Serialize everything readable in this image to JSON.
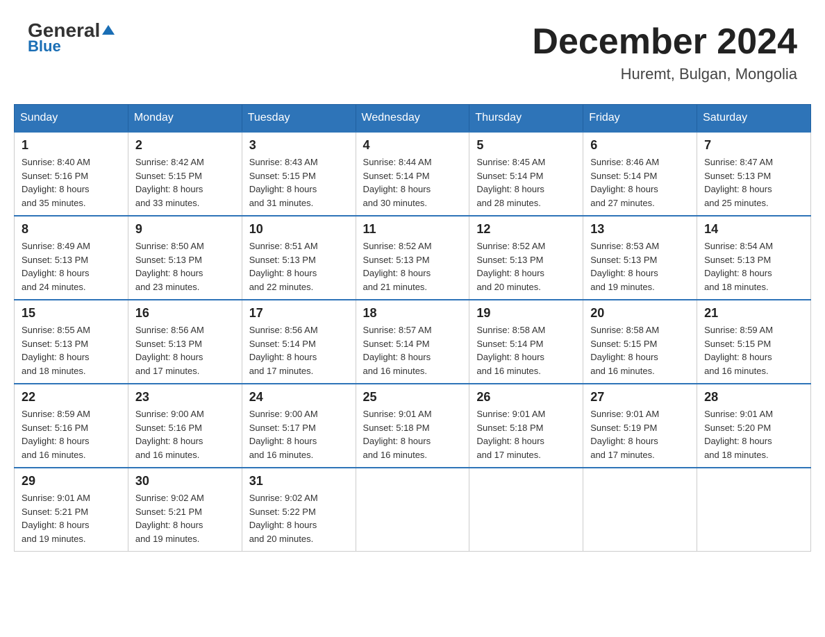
{
  "header": {
    "logo_main": "General",
    "logo_blue": "Blue",
    "month_title": "December 2024",
    "location": "Huremt, Bulgan, Mongolia"
  },
  "days_of_week": [
    "Sunday",
    "Monday",
    "Tuesday",
    "Wednesday",
    "Thursday",
    "Friday",
    "Saturday"
  ],
  "weeks": [
    [
      {
        "day": "1",
        "sunrise": "8:40 AM",
        "sunset": "5:16 PM",
        "daylight": "8 hours and 35 minutes."
      },
      {
        "day": "2",
        "sunrise": "8:42 AM",
        "sunset": "5:15 PM",
        "daylight": "8 hours and 33 minutes."
      },
      {
        "day": "3",
        "sunrise": "8:43 AM",
        "sunset": "5:15 PM",
        "daylight": "8 hours and 31 minutes."
      },
      {
        "day": "4",
        "sunrise": "8:44 AM",
        "sunset": "5:14 PM",
        "daylight": "8 hours and 30 minutes."
      },
      {
        "day": "5",
        "sunrise": "8:45 AM",
        "sunset": "5:14 PM",
        "daylight": "8 hours and 28 minutes."
      },
      {
        "day": "6",
        "sunrise": "8:46 AM",
        "sunset": "5:14 PM",
        "daylight": "8 hours and 27 minutes."
      },
      {
        "day": "7",
        "sunrise": "8:47 AM",
        "sunset": "5:13 PM",
        "daylight": "8 hours and 25 minutes."
      }
    ],
    [
      {
        "day": "8",
        "sunrise": "8:49 AM",
        "sunset": "5:13 PM",
        "daylight": "8 hours and 24 minutes."
      },
      {
        "day": "9",
        "sunrise": "8:50 AM",
        "sunset": "5:13 PM",
        "daylight": "8 hours and 23 minutes."
      },
      {
        "day": "10",
        "sunrise": "8:51 AM",
        "sunset": "5:13 PM",
        "daylight": "8 hours and 22 minutes."
      },
      {
        "day": "11",
        "sunrise": "8:52 AM",
        "sunset": "5:13 PM",
        "daylight": "8 hours and 21 minutes."
      },
      {
        "day": "12",
        "sunrise": "8:52 AM",
        "sunset": "5:13 PM",
        "daylight": "8 hours and 20 minutes."
      },
      {
        "day": "13",
        "sunrise": "8:53 AM",
        "sunset": "5:13 PM",
        "daylight": "8 hours and 19 minutes."
      },
      {
        "day": "14",
        "sunrise": "8:54 AM",
        "sunset": "5:13 PM",
        "daylight": "8 hours and 18 minutes."
      }
    ],
    [
      {
        "day": "15",
        "sunrise": "8:55 AM",
        "sunset": "5:13 PM",
        "daylight": "8 hours and 18 minutes."
      },
      {
        "day": "16",
        "sunrise": "8:56 AM",
        "sunset": "5:13 PM",
        "daylight": "8 hours and 17 minutes."
      },
      {
        "day": "17",
        "sunrise": "8:56 AM",
        "sunset": "5:14 PM",
        "daylight": "8 hours and 17 minutes."
      },
      {
        "day": "18",
        "sunrise": "8:57 AM",
        "sunset": "5:14 PM",
        "daylight": "8 hours and 16 minutes."
      },
      {
        "day": "19",
        "sunrise": "8:58 AM",
        "sunset": "5:14 PM",
        "daylight": "8 hours and 16 minutes."
      },
      {
        "day": "20",
        "sunrise": "8:58 AM",
        "sunset": "5:15 PM",
        "daylight": "8 hours and 16 minutes."
      },
      {
        "day": "21",
        "sunrise": "8:59 AM",
        "sunset": "5:15 PM",
        "daylight": "8 hours and 16 minutes."
      }
    ],
    [
      {
        "day": "22",
        "sunrise": "8:59 AM",
        "sunset": "5:16 PM",
        "daylight": "8 hours and 16 minutes."
      },
      {
        "day": "23",
        "sunrise": "9:00 AM",
        "sunset": "5:16 PM",
        "daylight": "8 hours and 16 minutes."
      },
      {
        "day": "24",
        "sunrise": "9:00 AM",
        "sunset": "5:17 PM",
        "daylight": "8 hours and 16 minutes."
      },
      {
        "day": "25",
        "sunrise": "9:01 AM",
        "sunset": "5:18 PM",
        "daylight": "8 hours and 16 minutes."
      },
      {
        "day": "26",
        "sunrise": "9:01 AM",
        "sunset": "5:18 PM",
        "daylight": "8 hours and 17 minutes."
      },
      {
        "day": "27",
        "sunrise": "9:01 AM",
        "sunset": "5:19 PM",
        "daylight": "8 hours and 17 minutes."
      },
      {
        "day": "28",
        "sunrise": "9:01 AM",
        "sunset": "5:20 PM",
        "daylight": "8 hours and 18 minutes."
      }
    ],
    [
      {
        "day": "29",
        "sunrise": "9:01 AM",
        "sunset": "5:21 PM",
        "daylight": "8 hours and 19 minutes."
      },
      {
        "day": "30",
        "sunrise": "9:02 AM",
        "sunset": "5:21 PM",
        "daylight": "8 hours and 19 minutes."
      },
      {
        "day": "31",
        "sunrise": "9:02 AM",
        "sunset": "5:22 PM",
        "daylight": "8 hours and 20 minutes."
      },
      null,
      null,
      null,
      null
    ]
  ],
  "labels": {
    "sunrise": "Sunrise:",
    "sunset": "Sunset:",
    "daylight": "Daylight:"
  }
}
